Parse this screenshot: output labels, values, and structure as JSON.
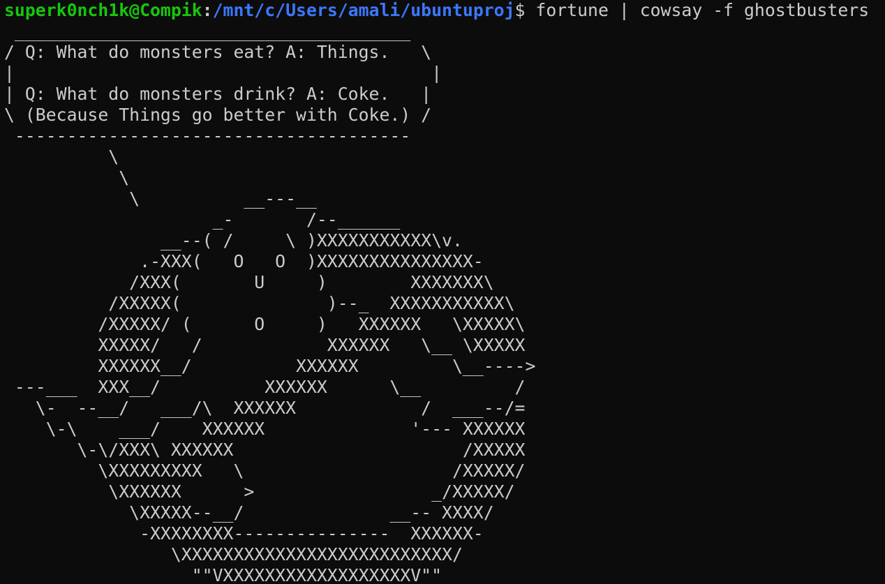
{
  "prompt": {
    "user_host": "superk0nch1k@Compik",
    "separator": ":",
    "path": "/mnt/c/Users/amali/ubuntuproj",
    "symbol": "$",
    "command": " fortune | cowsay -f ghostbusters"
  },
  "output": {
    "lines": [
      " ______________________________________",
      "/ Q: What do monsters eat? A: Things.   \\",
      "|                                        |",
      "| Q: What do monsters drink? A: Coke.   |",
      "\\ (Because Things go better with Coke.) /",
      " --------------------------------------",
      "          \\",
      "           \\",
      "            \\          __---__",
      "                    _-       /--______",
      "               __--( /     \\ )XXXXXXXXXXX\\v.",
      "             .-XXX(   O   O  )XXXXXXXXXXXXXXX-",
      "            /XXX(       U     )        XXXXXXX\\",
      "          /XXXXX(              )--_  XXXXXXXXXXX\\",
      "         /XXXXX/ (      O     )   XXXXXX   \\XXXXX\\",
      "         XXXXX/   /            XXXXXX   \\__ \\XXXXX",
      "         XXXXXX__/          XXXXXX         \\__---->",
      " ---___  XXX__/          XXXXXX      \\__         /",
      "   \\-  --__/   ___/\\  XXXXXX            /  ___--/=",
      "    \\-\\    ___/    XXXXXX              '--- XXXXXX",
      "       \\-\\/XXX\\ XXXXXX                      /XXXXX",
      "         \\XXXXXXXXX   \\                    /XXXXX/",
      "          \\XXXXXX      >                 _/XXXXX/",
      "            \\XXXXX--__/              __-- XXXX/",
      "             -XXXXXXXX---------------  XXXXXX-",
      "                \\XXXXXXXXXXXXXXXXXXXXXXXXXX/",
      "                  \"\"VXXXXXXXXXXXXXXXXXXV\"\""
    ]
  }
}
